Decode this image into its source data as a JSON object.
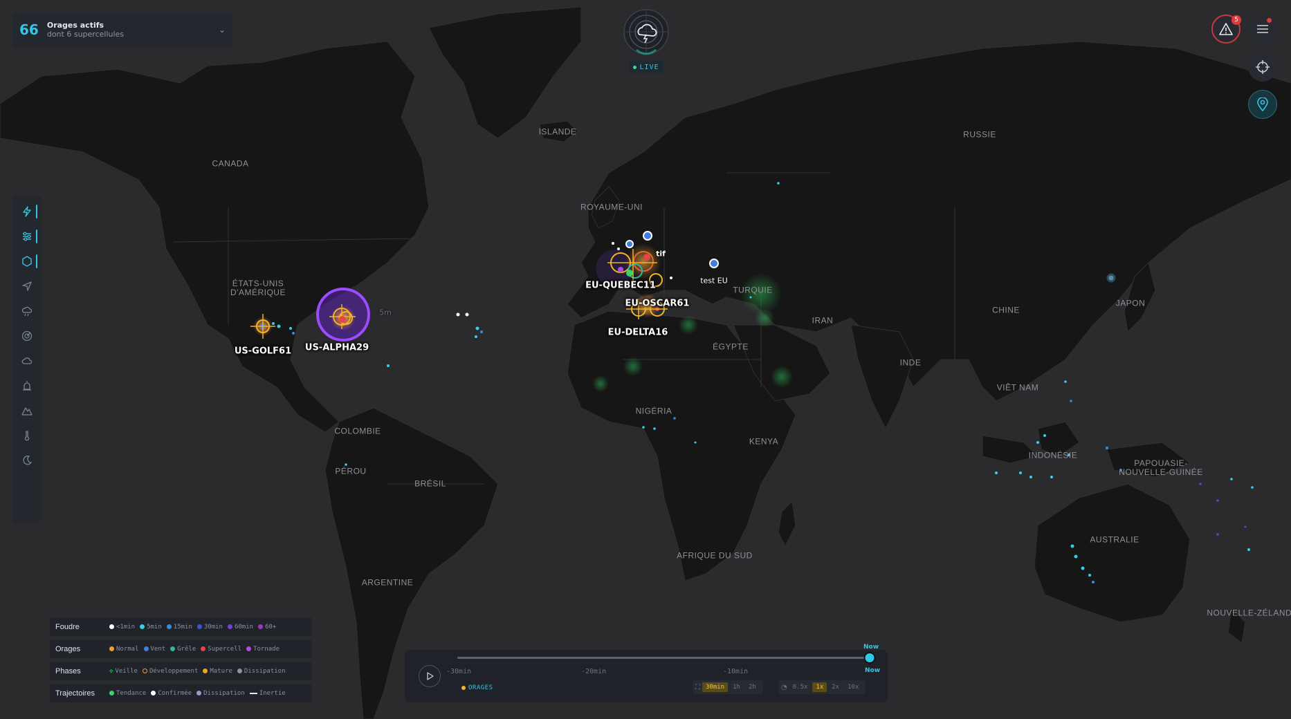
{
  "status": {
    "count": "66",
    "title": "Orages actifs",
    "subtitle": "dont 6 supercellules"
  },
  "live_label": "LIVE",
  "alerts": {
    "badge_count": "5"
  },
  "map": {
    "country_labels": [
      {
        "id": "islande",
        "text": "ISLANDE"
      },
      {
        "id": "canada",
        "text": "CANADA"
      },
      {
        "id": "usa",
        "text": "ÉTATS-UNIS\nD'AMÉRIQUE"
      },
      {
        "id": "uk",
        "text": "ROYAUME-UNI"
      },
      {
        "id": "russie",
        "text": "RUSSIE"
      },
      {
        "id": "turquie",
        "text": "TURQUIE"
      },
      {
        "id": "iran",
        "text": "IRAN"
      },
      {
        "id": "chine",
        "text": "CHINE"
      },
      {
        "id": "japon",
        "text": "JAPON"
      },
      {
        "id": "egypte",
        "text": "ÉGYPTE"
      },
      {
        "id": "inde",
        "text": "INDE"
      },
      {
        "id": "vietnam",
        "text": "VIÊT NAM"
      },
      {
        "id": "nigeria",
        "text": "NIGÉRIA"
      },
      {
        "id": "kenya",
        "text": "KENYA"
      },
      {
        "id": "colombie",
        "text": "COLOMBIE"
      },
      {
        "id": "perou",
        "text": "PÉROU"
      },
      {
        "id": "bresil",
        "text": "BRÉSIL"
      },
      {
        "id": "argentine",
        "text": "ARGENTINE"
      },
      {
        "id": "afrique_sud",
        "text": "AFRIQUE DU SUD"
      },
      {
        "id": "indonesie",
        "text": "INDONÉSIE"
      },
      {
        "id": "papouasie",
        "text": "PAPOUASIE-\nNOUVELLE-GUINÉE"
      },
      {
        "id": "australie",
        "text": "AUSTRALIE"
      },
      {
        "id": "nz",
        "text": "NOUVELLE-ZÉLANDE"
      }
    ],
    "storms": [
      {
        "id": "us-golf",
        "label": "US-GOLF61"
      },
      {
        "id": "us-alpha",
        "label": "US-ALPHA29"
      },
      {
        "id": "eu-quebec",
        "label": "EU-QUEBEC11"
      },
      {
        "id": "eu-oscar",
        "label": "EU-OSCAR61"
      },
      {
        "id": "eu-delta",
        "label": "EU-DELTA16"
      }
    ],
    "extra_labels": {
      "test_eu": "test EU",
      "tif": "tif",
      "five_m": "5m"
    }
  },
  "legend": [
    {
      "category": "Foudre",
      "items": [
        {
          "label": "<1min",
          "color": "#ffffff"
        },
        {
          "label": "5min",
          "color": "#35d0ee"
        },
        {
          "label": "15min",
          "color": "#2f8fe0"
        },
        {
          "label": "30min",
          "color": "#3a55d8"
        },
        {
          "label": "60min",
          "color": "#7b3fd6"
        },
        {
          "label": "60+",
          "color": "#9c37c9"
        }
      ]
    },
    {
      "category": "Orages",
      "items": [
        {
          "label": "Normal",
          "color": "#f0a325"
        },
        {
          "label": "Vent",
          "color": "#3f7fe0"
        },
        {
          "label": "Grêle",
          "color": "#2bb8a6"
        },
        {
          "label": "Supercell",
          "color": "#e64545"
        },
        {
          "label": "Tornade",
          "color": "#b44be0"
        }
      ]
    },
    {
      "category": "Phases",
      "items": [
        {
          "label": "Veille",
          "color": "#3bd46b",
          "style": "cross"
        },
        {
          "label": "Développement",
          "color": "#f0a325",
          "style": "ring"
        },
        {
          "label": "Mature",
          "color": "#f0a325"
        },
        {
          "label": "Dissipation",
          "color": "#8a929d"
        }
      ]
    },
    {
      "category": "Trajectoires",
      "items": [
        {
          "label": "Tendance",
          "color": "#3bd46b"
        },
        {
          "label": "Confirmée",
          "color": "#ffffff"
        },
        {
          "label": "Dissipation",
          "color": "#8aa0c8"
        },
        {
          "label": "Inertie",
          "color": "#e8eaed",
          "style": "line"
        }
      ]
    }
  ],
  "timeline": {
    "now_top": "Now",
    "now_label": "Now",
    "ticks": [
      "-30min",
      "-20min",
      "-10min"
    ],
    "layer_tag": "ORAGES",
    "durations": [
      "30min",
      "1h",
      "2h"
    ],
    "active_duration": "30min",
    "speeds": [
      "0.5x",
      "1x",
      "2x",
      "10x"
    ],
    "active_speed": "1x",
    "position_fraction": 1.0
  },
  "toolbar": {
    "tools": [
      {
        "name": "lightning-icon",
        "active": true
      },
      {
        "name": "layers-sliders-icon",
        "active": true
      },
      {
        "name": "hexagon-icon",
        "active": true
      },
      {
        "name": "navigation-icon",
        "active": false
      },
      {
        "name": "rain-cloud-icon",
        "active": false
      },
      {
        "name": "radar-icon",
        "active": false
      },
      {
        "name": "cloud-icon",
        "active": false
      },
      {
        "name": "alarm-icon",
        "active": false
      },
      {
        "name": "terrain-icon",
        "active": false
      },
      {
        "name": "thermometer-icon",
        "active": false
      },
      {
        "name": "moon-icon",
        "active": false
      }
    ]
  },
  "colors": {
    "accent": "#35c5e6",
    "alert": "#e5383b",
    "land": "#161616",
    "ocean": "#2b2b2d"
  }
}
